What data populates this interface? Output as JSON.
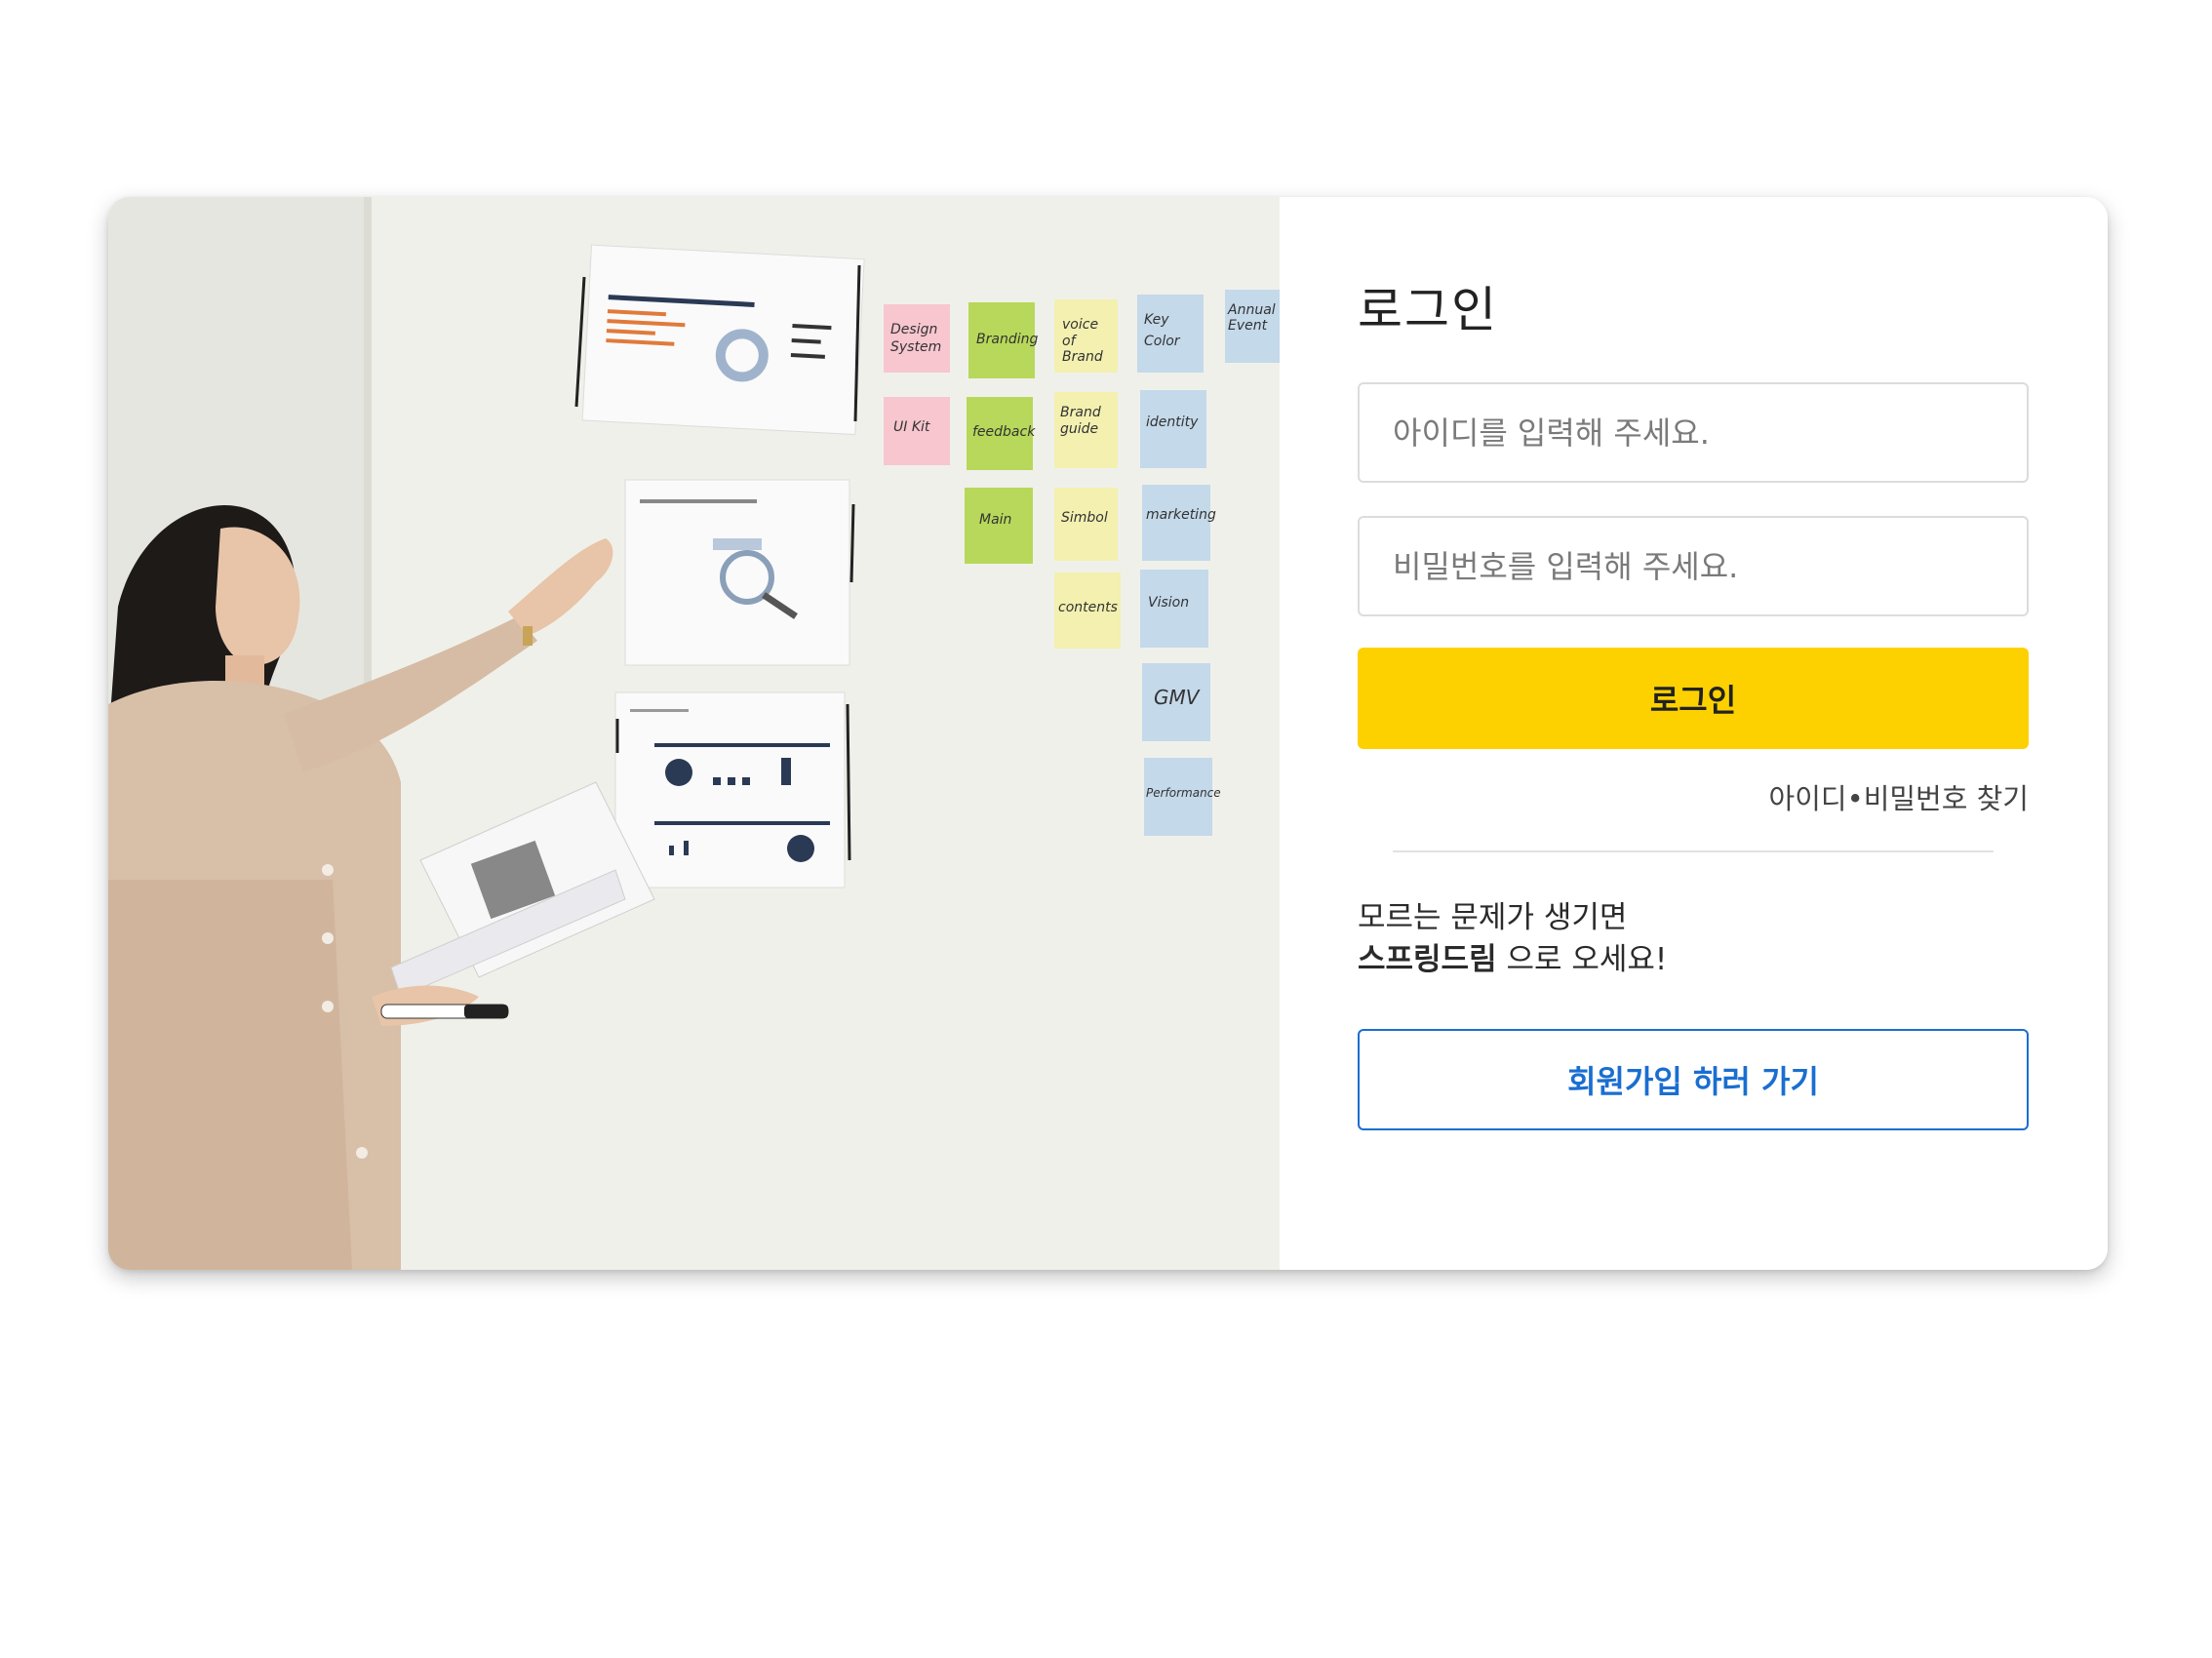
{
  "login": {
    "title": "로그인",
    "id_placeholder": "아이디를 입력해 주세요.",
    "password_placeholder": "비밀번호를 입력해 주세요.",
    "submit_label": "로그인",
    "find_link": "아이디•비밀번호 찾기"
  },
  "help": {
    "line1": "모르는 문제가 생기면",
    "brand": "스프링드림",
    "line2_suffix": " 으로 오세요!"
  },
  "signup": {
    "label": "회원가입 하러 가기"
  },
  "hero": {
    "notes": [
      "Design System",
      "Branding",
      "voice of Brand",
      "Key Color",
      "Annual Event",
      "UI Kit",
      "feedback",
      "Brand guide",
      "identity",
      "Main",
      "Simbol",
      "marketing",
      "contents",
      "Vision",
      "GMV",
      "Performance"
    ]
  },
  "colors": {
    "primary_button": "#fdd100",
    "signup_accent": "#1a6ed0",
    "note_pink": "#f7c6cf",
    "note_green": "#b7d85a",
    "note_yellow": "#f3f0b0",
    "note_blue": "#c4d9ea"
  }
}
